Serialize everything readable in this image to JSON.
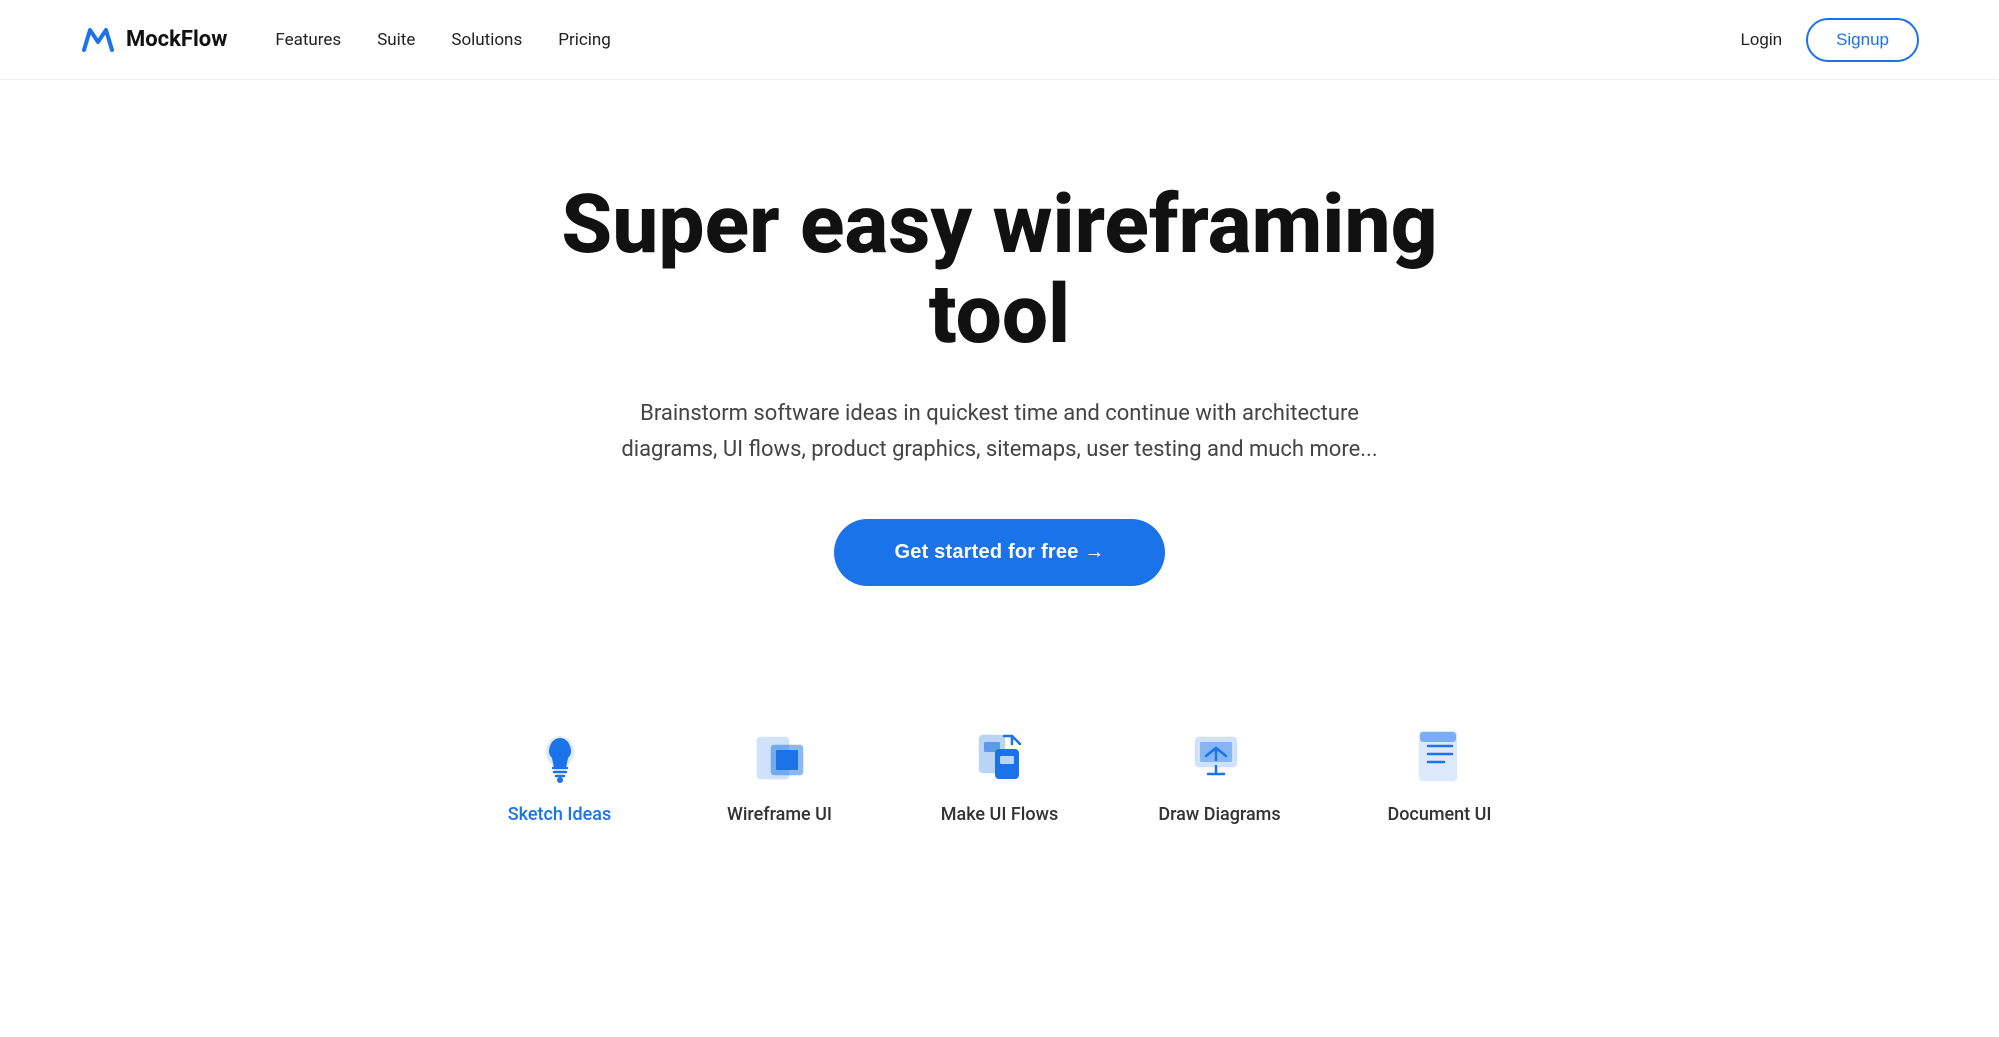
{
  "nav": {
    "logo_text": "MockFlow",
    "links": [
      {
        "label": "Features",
        "id": "features"
      },
      {
        "label": "Suite",
        "id": "suite"
      },
      {
        "label": "Solutions",
        "id": "solutions"
      },
      {
        "label": "Pricing",
        "id": "pricing"
      }
    ],
    "login_label": "Login",
    "signup_label": "Signup"
  },
  "hero": {
    "title": "Super easy wireframing tool",
    "subtitle": "Brainstorm software ideas in quickest time and continue with architecture diagrams, UI flows, product graphics, sitemaps, user testing and much more...",
    "cta_label": "Get started for free →"
  },
  "features": [
    {
      "label": "Sketch Ideas",
      "id": "sketch-ideas",
      "active": true
    },
    {
      "label": "Wireframe UI",
      "id": "wireframe-ui",
      "active": false
    },
    {
      "label": "Make UI Flows",
      "id": "make-ui-flows",
      "active": false
    },
    {
      "label": "Draw Diagrams",
      "id": "draw-diagrams",
      "active": false
    },
    {
      "label": "Document UI",
      "id": "document-ui",
      "active": false
    }
  ],
  "colors": {
    "brand_blue": "#1a73e8",
    "text_dark": "#111111",
    "text_mid": "#444444",
    "text_light": "#999999"
  }
}
